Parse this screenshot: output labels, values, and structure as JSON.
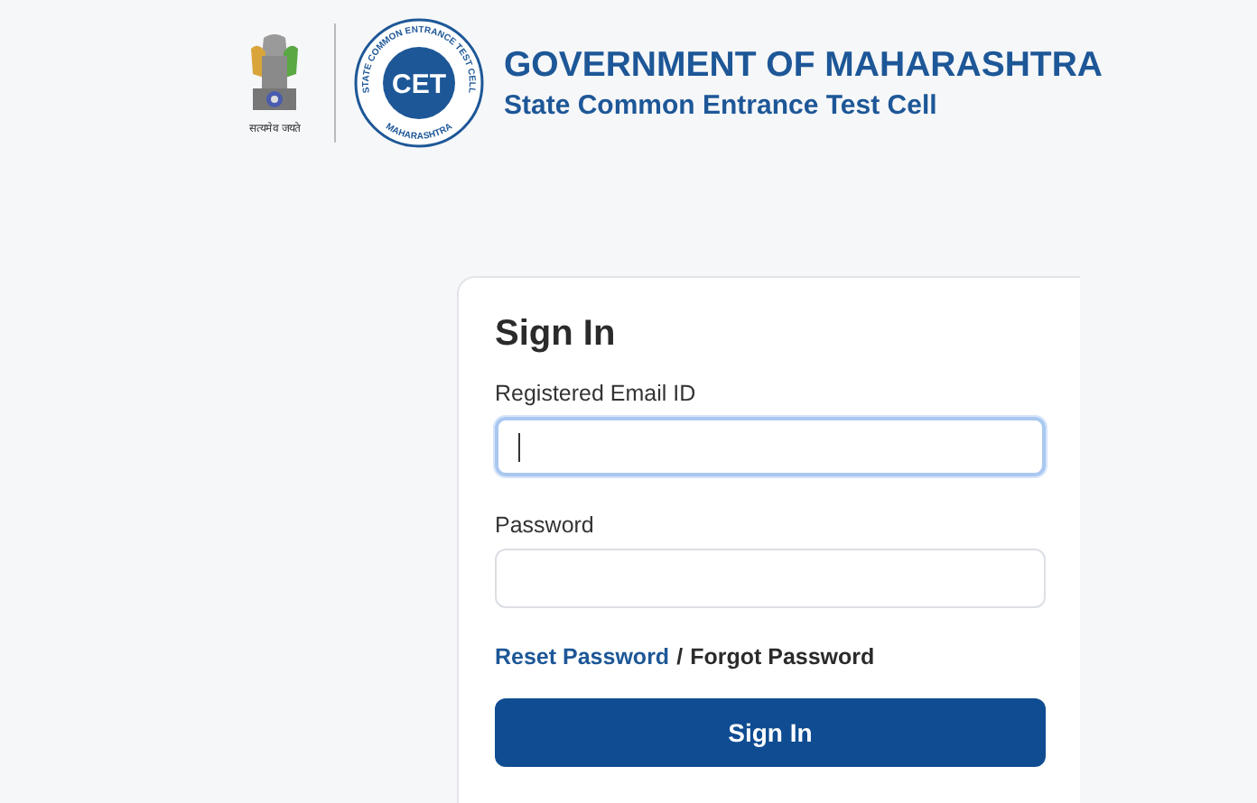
{
  "header": {
    "emblem_motto": "सत्यमेव जयते",
    "logo": {
      "mark": "CET",
      "ring_top": "STATE COMMON ENTRANCE TEST CELL",
      "ring_bottom": "MAHARASHTRA"
    },
    "title": "GOVERNMENT OF MAHARASHTRA",
    "subtitle": "State Common Entrance Test Cell"
  },
  "form": {
    "heading": "Sign In",
    "fields": [
      {
        "label": "Registered Email ID",
        "focused": true
      },
      {
        "label": "Password",
        "focused": false
      }
    ],
    "links": [
      {
        "text": "Reset Password",
        "kind": "link"
      },
      {
        "text": "/",
        "kind": "separator"
      },
      {
        "text": "Forgot Password",
        "kind": "plain"
      }
    ],
    "button": "Sign In"
  }
}
